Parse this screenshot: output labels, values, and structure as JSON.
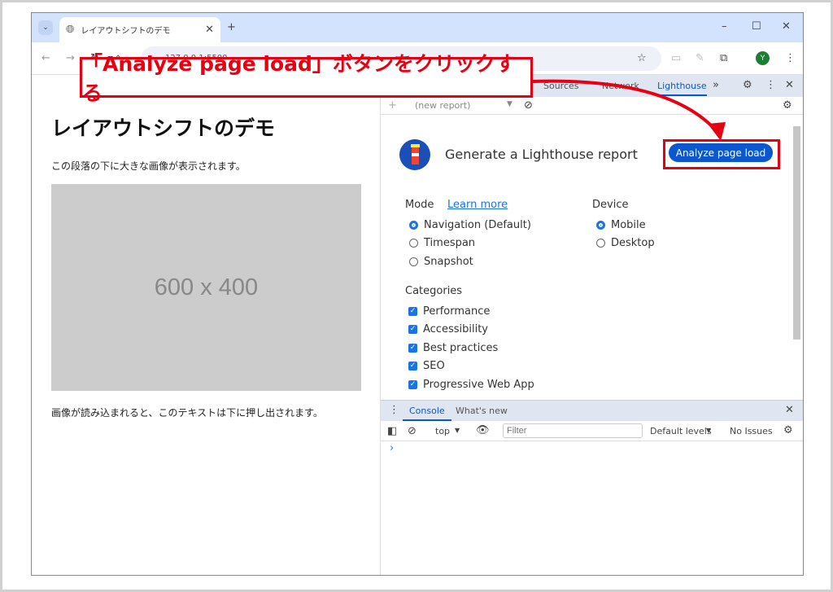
{
  "browser": {
    "tab_title": "レイアウトシフトのデモ",
    "url": "127.0.0.1:5500",
    "profile_initial": "Y"
  },
  "page": {
    "heading": "レイアウトシフトのデモ",
    "para1": "この段落の下に大きな画像が表示されます。",
    "placeholder": "600 x 400",
    "para2": "画像が読み込まれると、このテキストは下に押し出されます。"
  },
  "devtools": {
    "tabs": [
      "Sources",
      "Network",
      "Lighthouse"
    ],
    "active_tab": "Lighthouse",
    "report_select": "(new report)",
    "lighthouse": {
      "title": "Generate a Lighthouse report",
      "analyze_button": "Analyze page load",
      "mode_label": "Mode",
      "learn_more": "Learn more",
      "modes": [
        {
          "label": "Navigation (Default)",
          "checked": true
        },
        {
          "label": "Timespan",
          "checked": false
        },
        {
          "label": "Snapshot",
          "checked": false
        }
      ],
      "device_label": "Device",
      "devices": [
        {
          "label": "Mobile",
          "checked": true
        },
        {
          "label": "Desktop",
          "checked": false
        }
      ],
      "categories_label": "Categories",
      "categories": [
        {
          "label": "Performance",
          "checked": true
        },
        {
          "label": "Accessibility",
          "checked": true
        },
        {
          "label": "Best practices",
          "checked": true
        },
        {
          "label": "SEO",
          "checked": true
        },
        {
          "label": "Progressive Web App",
          "checked": true
        }
      ]
    },
    "drawer": {
      "tabs": [
        "Console",
        "What's new"
      ],
      "context": "top",
      "filter_placeholder": "Filter",
      "levels": "Default levels",
      "issues": "No Issues",
      "prompt": "›"
    }
  },
  "annotation": {
    "text": "「Analyze page load」ボタンをクリックする",
    "color": "#e60012"
  }
}
